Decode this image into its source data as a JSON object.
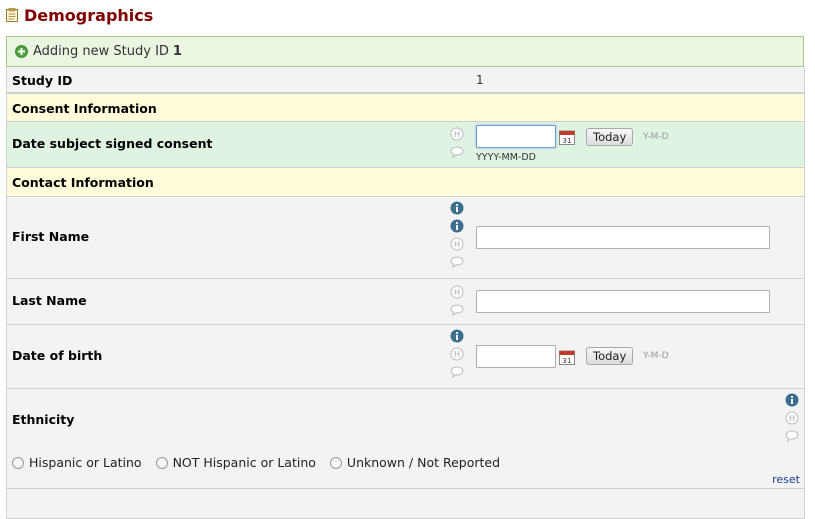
{
  "form": {
    "title": "Demographics"
  },
  "status": {
    "prefix": "Adding new Study ID",
    "record_id": "1"
  },
  "fields": {
    "study_id": {
      "label": "Study ID",
      "value": "1"
    },
    "consent_section": {
      "label": "Consent Information"
    },
    "consent_date": {
      "label": "Date subject signed consent",
      "value": "",
      "today_label": "Today",
      "format_hint": "Y-M-D",
      "format_under": "YYYY-MM-DD"
    },
    "contact_section": {
      "label": "Contact Information"
    },
    "first_name": {
      "label": "First Name",
      "value": ""
    },
    "last_name": {
      "label": "Last Name",
      "value": ""
    },
    "dob": {
      "label": "Date of birth",
      "value": "",
      "today_label": "Today",
      "format_hint": "Y-M-D"
    },
    "ethnicity": {
      "label": "Ethnicity",
      "options": [
        "Hispanic or Latino",
        "NOT Hispanic or Latino",
        "Unknown / Not Reported"
      ],
      "reset_label": "reset"
    }
  },
  "colors": {
    "title": "#800000",
    "status_bg": "#eaf5e2",
    "section_bg": "#fffcd9",
    "consent_bg": "#dff3e3",
    "info_icon": "#3b6e8f"
  },
  "icons": [
    "form-icon",
    "add-icon",
    "history-icon",
    "comment-icon",
    "info-icon",
    "calendar-icon"
  ]
}
